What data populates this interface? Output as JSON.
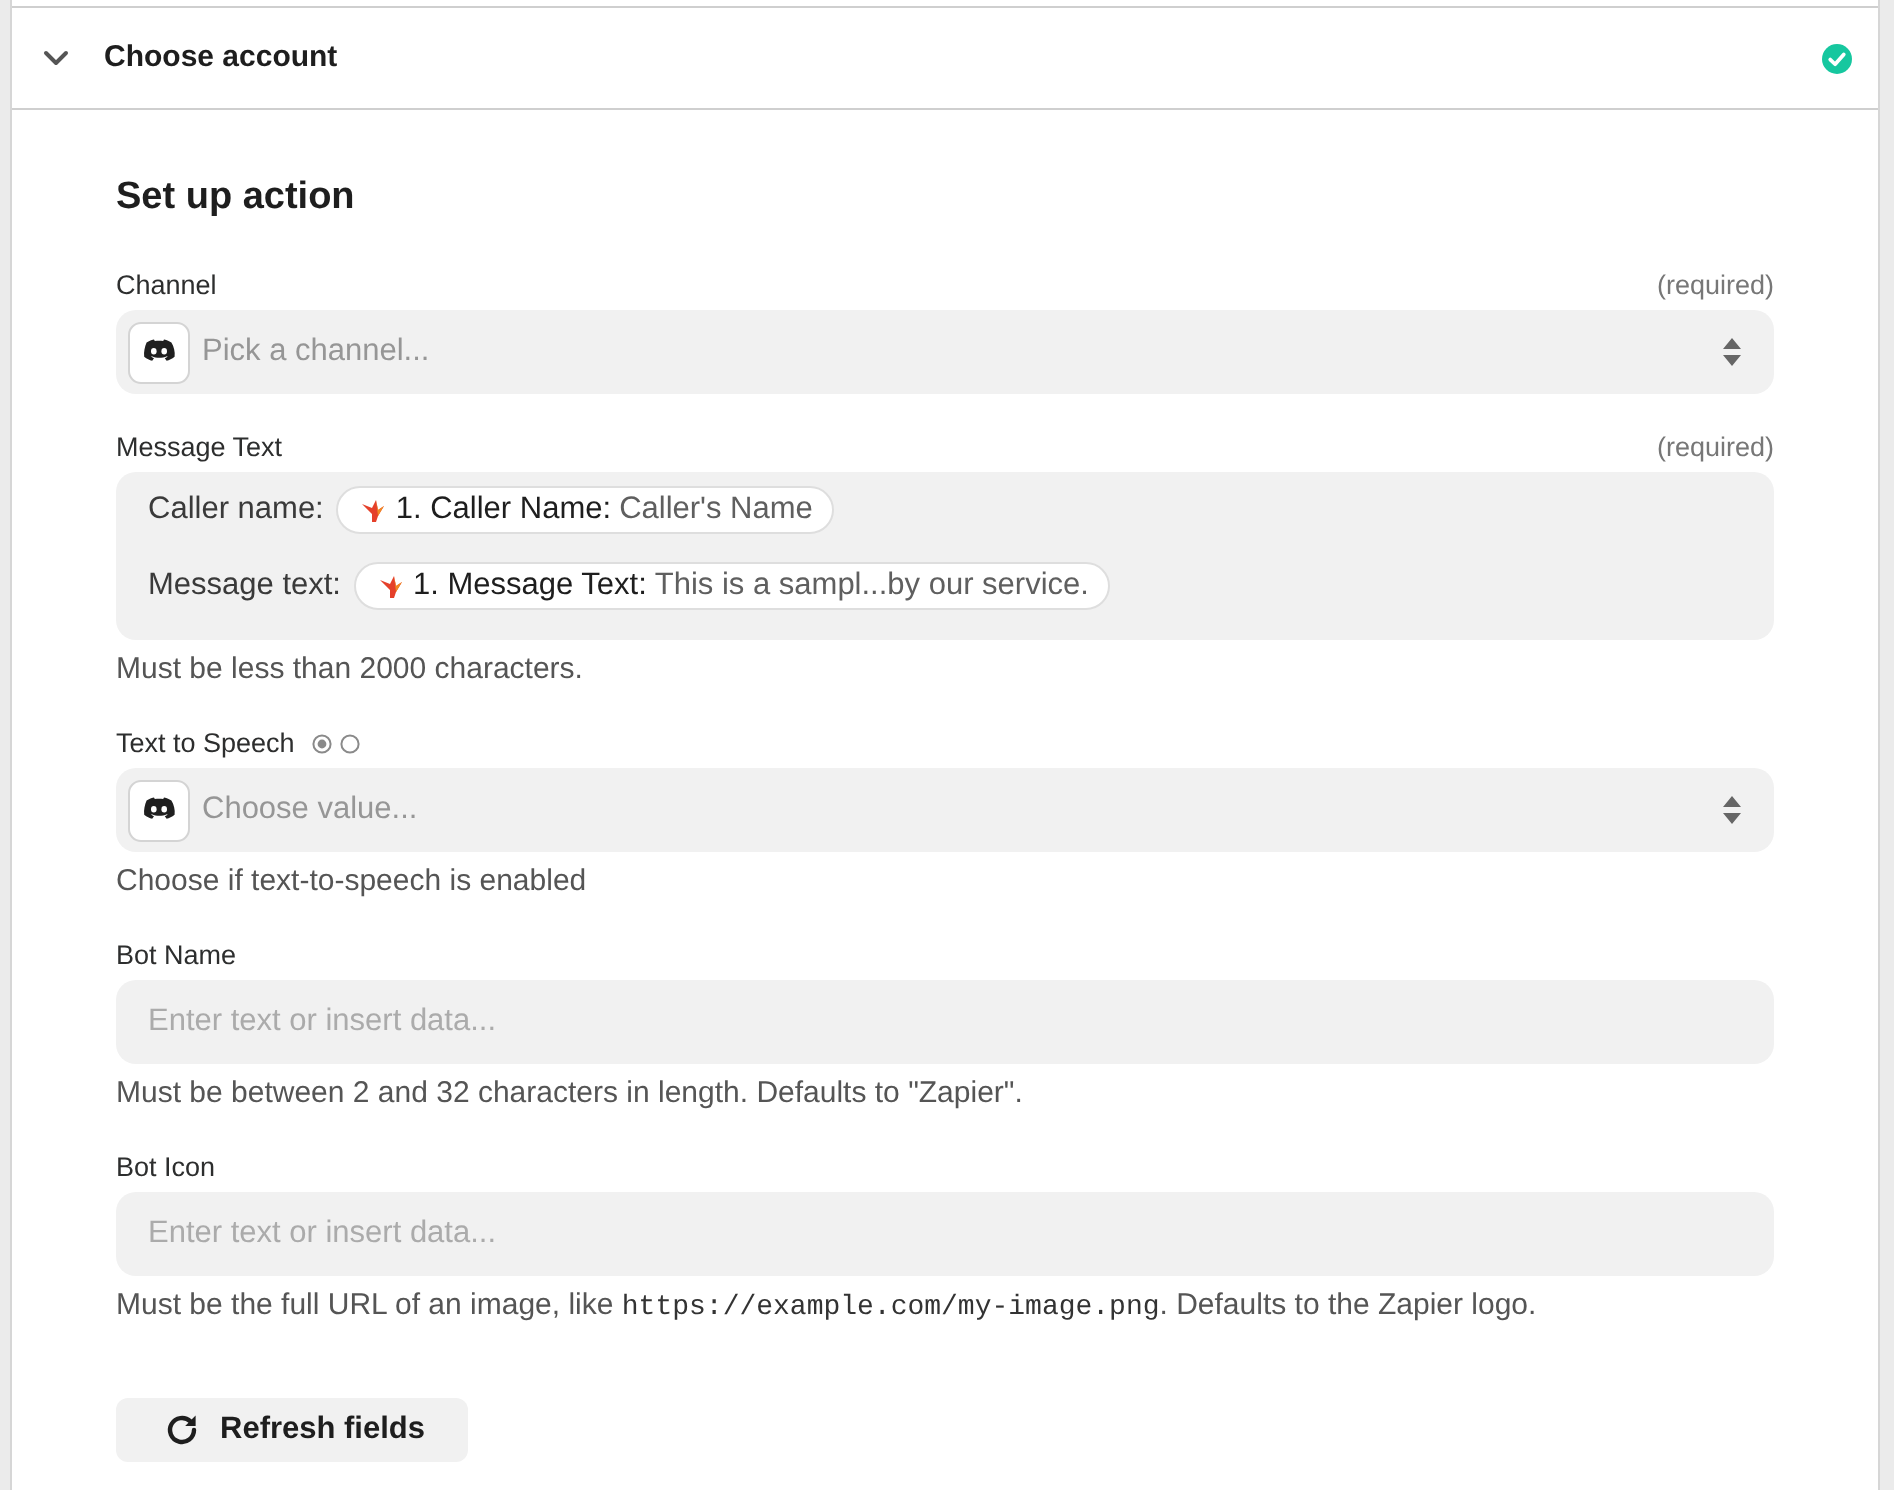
{
  "header": {
    "title": "Choose account",
    "expanded": true,
    "complete": true
  },
  "section_title": "Set up action",
  "fields": [
    {
      "kind": "select",
      "label": "Channel",
      "required_note": "(required)",
      "placeholder": "Pick a channel..."
    },
    {
      "kind": "mapped",
      "label": "Message Text",
      "required_note": "(required)",
      "lines": [
        {
          "label": "Caller name:",
          "pill": {
            "step": "1. Caller Name:",
            "value": "Caller's Name"
          }
        },
        {
          "label": "Message text:",
          "pill": {
            "step": "1. Message Text:",
            "value": "This is a sampl...by our service."
          }
        }
      ],
      "help": [
        {
          "kind": "text",
          "text": "Must be less than 2000 characters."
        }
      ]
    },
    {
      "kind": "select",
      "label": "Text to Speech",
      "mode_options": [
        {
          "selected": true
        },
        {
          "selected": false
        }
      ],
      "placeholder": "Choose value...",
      "help": [
        {
          "kind": "text",
          "text": "Choose if text-to-speech is enabled"
        }
      ]
    },
    {
      "kind": "text",
      "label": "Bot Name",
      "placeholder": "Enter text or insert data...",
      "help": [
        {
          "kind": "text",
          "text": "Must be between 2 and 32 characters in length. Defaults to \"Zapier\"."
        }
      ]
    },
    {
      "kind": "text",
      "label": "Bot Icon",
      "placeholder": "Enter text or insert data...",
      "help": [
        {
          "kind": "text",
          "text": "Must be the full URL of an image, like "
        },
        {
          "kind": "code",
          "text": "https://example.com/my-image.png"
        },
        {
          "kind": "text",
          "text": ". Defaults to the Zapier logo."
        }
      ]
    }
  ],
  "refresh_button": {
    "label": "Refresh fields"
  }
}
